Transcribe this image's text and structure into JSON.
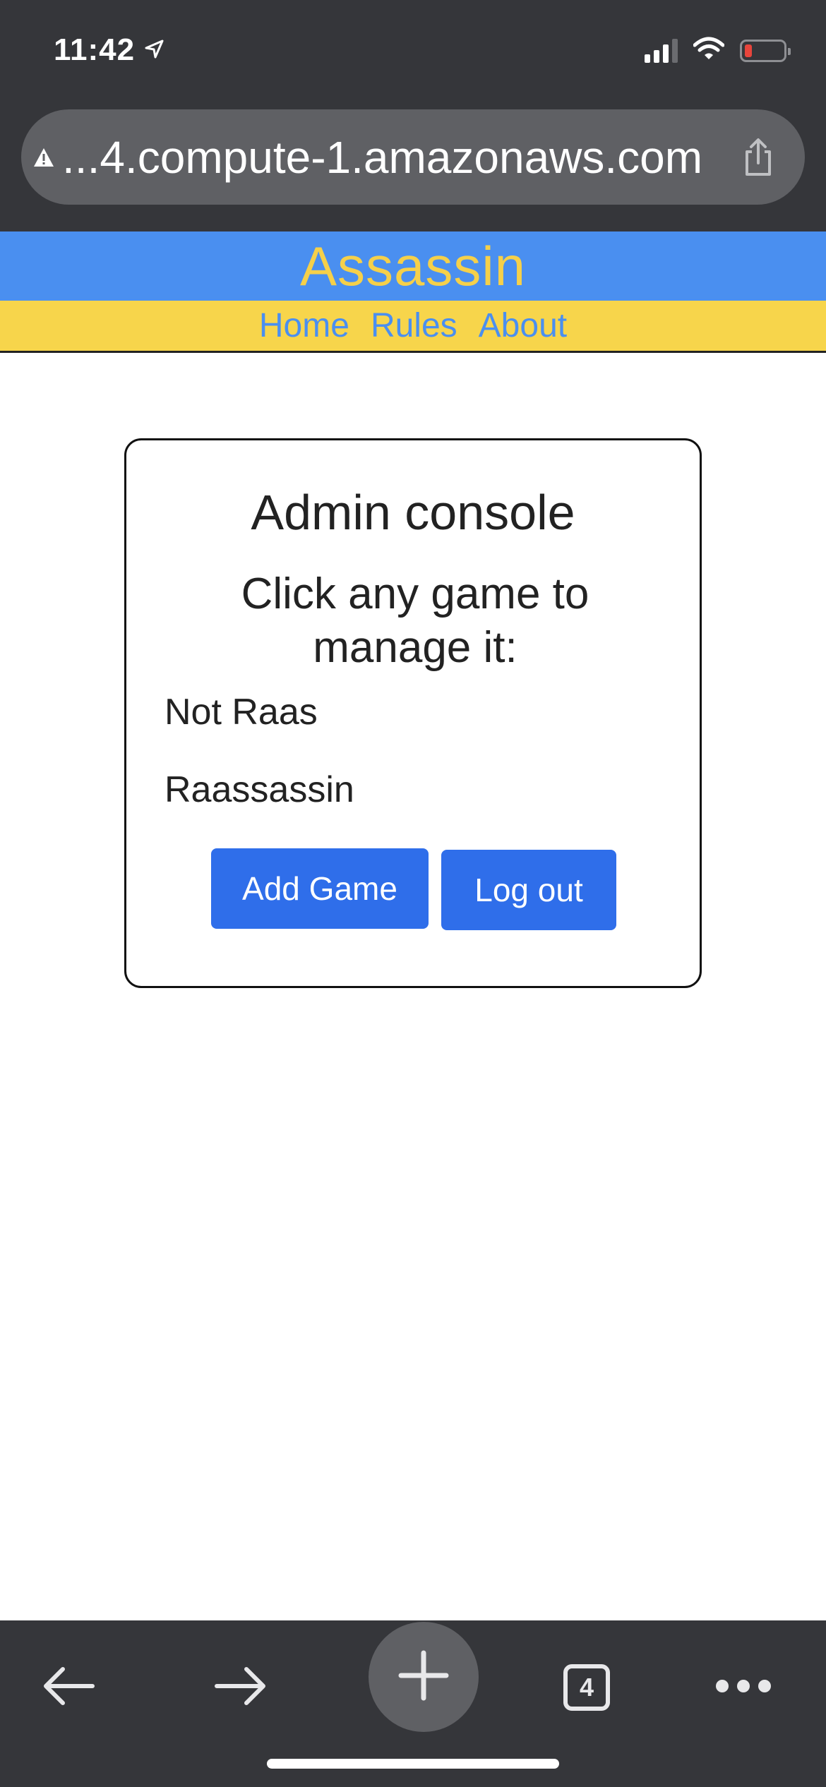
{
  "status_bar": {
    "time": "11:42",
    "icons": [
      "location-arrow-icon",
      "signal-icon",
      "wifi-icon",
      "battery-icon"
    ]
  },
  "browser": {
    "url": "...4.compute-1.amazonaws.com",
    "security_icon": "warning-icon",
    "share_icon": "share-icon"
  },
  "site": {
    "title": "Assassin",
    "nav": [
      "Home",
      "Rules",
      "About"
    ],
    "colors": {
      "header": "#4a8ff0",
      "title": "#f5d04a",
      "nav_bar": "#f7d54b",
      "nav_link": "#4a8ff0"
    }
  },
  "console": {
    "title": "Admin console",
    "subtitle": "Click any game to manage it:",
    "games": [
      "Not Raas",
      "Raassassin"
    ],
    "add_game_label": "Add Game",
    "logout_label": "Log out",
    "button_color": "#2f6eea"
  },
  "toolbar": {
    "tab_count": "4",
    "icons": [
      "back-arrow-icon",
      "forward-arrow-icon",
      "new-tab-plus-icon",
      "tab-switcher-icon",
      "more-dots-icon"
    ]
  }
}
